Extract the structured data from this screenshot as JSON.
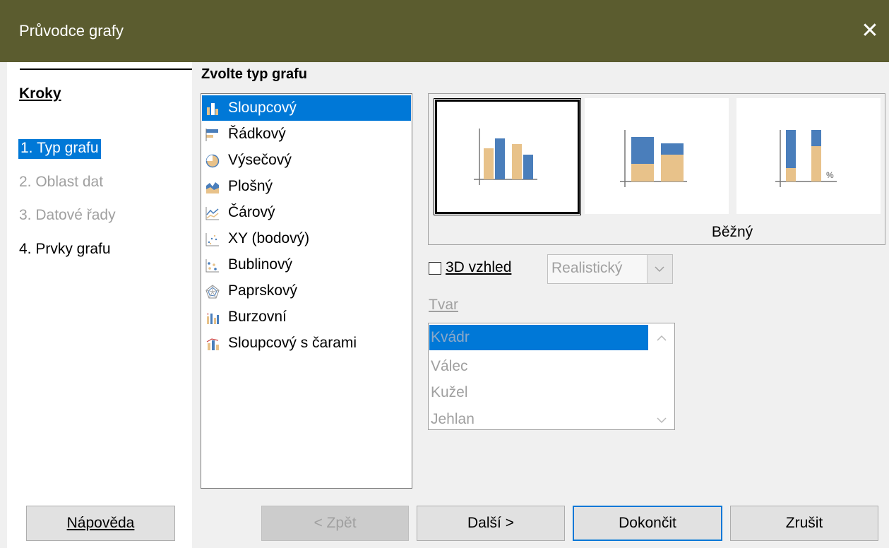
{
  "window": {
    "title": "Průvodce grafy",
    "close_glyph": "✕"
  },
  "steps": {
    "heading": "Kroky",
    "items": [
      {
        "label": "1. Typ grafu",
        "state": "active"
      },
      {
        "label": "2. Oblast dat",
        "state": "disabled"
      },
      {
        "label": "3. Datové řady",
        "state": "disabled"
      },
      {
        "label": "4. Prvky grafu",
        "state": "enabled"
      }
    ]
  },
  "chart_type": {
    "heading": "Zvolte typ grafu",
    "types": [
      {
        "label": "Sloupcový",
        "icon": "column-chart-icon",
        "selected": true
      },
      {
        "label": "Řádkový",
        "icon": "bar-chart-icon"
      },
      {
        "label": "Výsečový",
        "icon": "pie-chart-icon"
      },
      {
        "label": "Plošný",
        "icon": "area-chart-icon"
      },
      {
        "label": "Čárový",
        "icon": "line-chart-icon"
      },
      {
        "label": "XY (bodový)",
        "icon": "scatter-chart-icon"
      },
      {
        "label": "Bublinový",
        "icon": "bubble-chart-icon"
      },
      {
        "label": "Paprskový",
        "icon": "net-chart-icon"
      },
      {
        "label": "Burzovní",
        "icon": "stock-chart-icon"
      },
      {
        "label": "Sloupcový s čarami",
        "icon": "column-line-chart-icon"
      }
    ],
    "variants": [
      {
        "icon": "normal-column-variant-icon",
        "selected": true
      },
      {
        "icon": "stacked-column-variant-icon"
      },
      {
        "icon": "percent-stacked-column-variant-icon",
        "percent_glyph": "%"
      }
    ],
    "variant_name": "Běžný"
  },
  "options": {
    "three_d_label": "3D vzhled",
    "three_d_checked": false,
    "scheme_value": "Realistický",
    "shape_label": "Tvar",
    "shapes": [
      "Kvádr",
      "Válec",
      "Kužel",
      "Jehlan"
    ],
    "shape_selected_index": 0
  },
  "buttons": {
    "help": "Nápověda",
    "back": "< Zpět",
    "next": "Další >",
    "finish": "Dokončit",
    "cancel": "Zrušit"
  },
  "colors": {
    "titlebar": "#5b5c2f",
    "selection": "#0078d7",
    "chart_blue": "#4a7ebb",
    "chart_tan": "#e8c28a"
  }
}
